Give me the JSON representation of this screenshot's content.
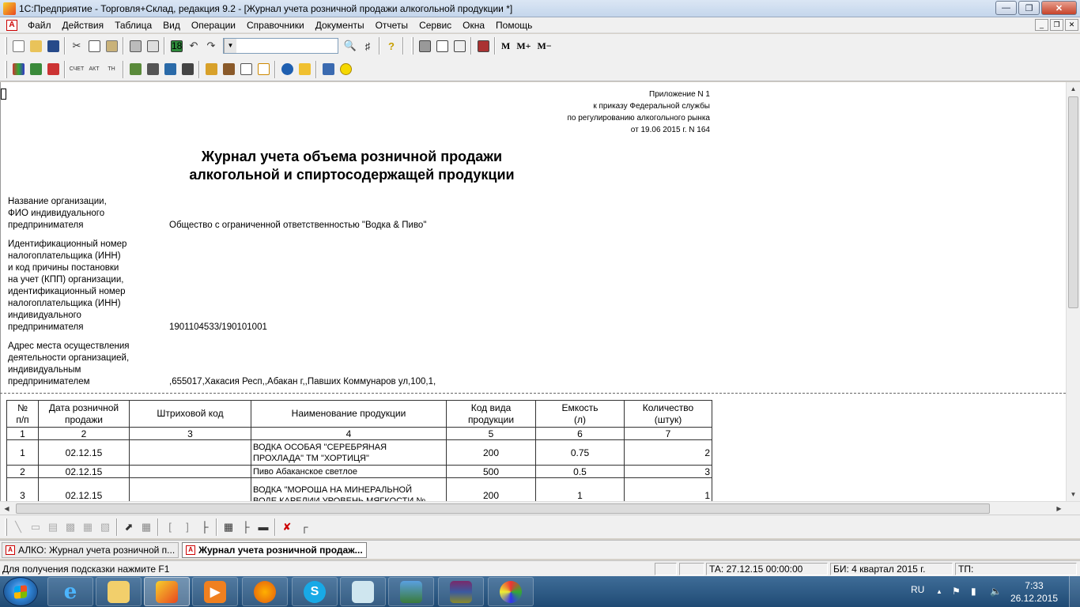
{
  "window": {
    "title": "1С:Предприятие - Торговля+Склад, редакция 9.2 - [Журнал учета розничной продажи алкогольной продукции  *]"
  },
  "menu": [
    "Файл",
    "Действия",
    "Таблица",
    "Вид",
    "Операции",
    "Справочники",
    "Документы",
    "Отчеты",
    "Сервис",
    "Окна",
    "Помощь"
  ],
  "toolbar": {
    "font_size_value": "18",
    "memory_buttons": [
      "M",
      "M+",
      "M−"
    ]
  },
  "document": {
    "appendix": [
      "Приложение N 1",
      "к приказу Федеральной службы",
      "по регулированию алкогольного рынка",
      "от 19.06 2015 г. N 164"
    ],
    "title_line1": "Журнал учета объема розничной продажи",
    "title_line2": "алкогольной и спиртосодержащей продукции",
    "org_label": [
      "Название организации,",
      "ФИО индивидуального",
      "предпринимателя"
    ],
    "org_value": "Общество с ограниченной ответственностью \"Водка & Пиво\"",
    "inn_label": [
      "Идентификационный номер",
      "налогоплательщика (ИНН)",
      "и код причины постановки",
      "на учет (КПП) организации,",
      "идентификационный номер",
      "налогоплательщика (ИНН)",
      "индивидуального",
      "предпринимателя"
    ],
    "inn_value": "1901104533/190101001",
    "addr_label": [
      "Адрес места осуществления",
      "деятельности организацией,",
      "индивидуальным",
      "предпринимателем"
    ],
    "addr_value": ",655017,Хакасия Респ,,Абакан г,,Павших Коммунаров ул,100,1,"
  },
  "table": {
    "headers": [
      [
        "№",
        "п/п"
      ],
      [
        "Дата розничной",
        "продажи"
      ],
      [
        "Штриховой код"
      ],
      [
        "Наименование продукции"
      ],
      [
        "Код вида",
        "продукции"
      ],
      [
        "Емкость",
        "(л)"
      ],
      [
        "Количество",
        "(штук)"
      ]
    ],
    "column_numbers": [
      "1",
      "2",
      "3",
      "4",
      "5",
      "6",
      "7"
    ],
    "rows": [
      {
        "n": "1",
        "date": "02.12.15",
        "barcode": "",
        "name": [
          "ВОДКА ОСОБАЯ \"СЕРЕБРЯНАЯ",
          "ПРОХЛАДА\" ТМ \"ХОРТИЦЯ\""
        ],
        "code": "200",
        "volume": "0.75",
        "qty": "2"
      },
      {
        "n": "2",
        "date": "02.12.15",
        "barcode": "",
        "name": [
          "Пиво Абаканское светлое"
        ],
        "code": "500",
        "volume": "0.5",
        "qty": "3"
      },
      {
        "n": "3",
        "date": "02.12.15",
        "barcode": "",
        "name": [
          "ВОДКА \"МОРОША НА МИНЕРАЛЬНОЙ",
          "ВОДЕ КАРЕЛИИ УРОВЕНЬ МЯГКОСТИ №"
        ],
        "code": "200",
        "volume": "1",
        "qty": "1"
      }
    ]
  },
  "window_tabs": [
    {
      "label": "АЛКО: Журнал учета розничной п...",
      "active": false
    },
    {
      "label": "Журнал учета розничной продаж...",
      "active": true
    }
  ],
  "status": {
    "hint": "Для получения подсказки нажмите F1",
    "ta": "ТА: 27.12.15  00:00:00",
    "bi": "БИ: 4 квартал 2015 г.",
    "tp": "ТП:"
  },
  "taskbar": {
    "apps": [
      "internet-explorer",
      "file-explorer",
      "1c-enterprise",
      "media-player",
      "firefox",
      "skype",
      "notepad",
      "image-viewer",
      "winrar",
      "paint"
    ],
    "language": "RU",
    "time": "7:33",
    "date": "26.12.2015"
  },
  "colors": {
    "title_gradient_top": "#dbe6f4",
    "taskbar": "#2a5885",
    "doc_bg": "#ffffff"
  }
}
